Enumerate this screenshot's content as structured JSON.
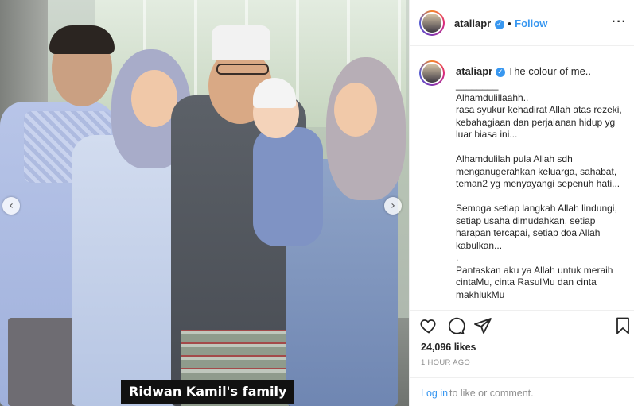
{
  "photo": {
    "caption_tag": "Ridwan Kamil's family",
    "prev_icon": "chevron-left-icon",
    "next_icon": "chevron-right-icon"
  },
  "header": {
    "username": "ataliapr",
    "separator": "•",
    "follow_label": "Follow",
    "more_label": "···"
  },
  "post": {
    "username": "ataliapr",
    "caption_first": "The colour of me..",
    "caption_body": "________\nAlhamdulillaahh..\nrasa syukur kehadirat Allah atas rezeki, kebahagiaan dan perjalanan hidup yg luar biasa ini...\n\nAlhamdulilah pula Allah sdh menganugerahkan keluarga, sahabat, teman2 yg menyayangi sepenuh hati...\n\nSemoga setiap langkah Allah lindungi, setiap usaha dimudahkan, setiap harapan tercapai, setiap doa Allah kabulkan...\n.\nPantaskan aku ya Allah untuk meraih cintaMu, cinta RasulMu dan cinta makhlukMu"
  },
  "actions": {
    "likes": "24,096 likes",
    "time": "1 HOUR AGO",
    "login_label": "Log in",
    "login_rest": "to like or comment."
  }
}
